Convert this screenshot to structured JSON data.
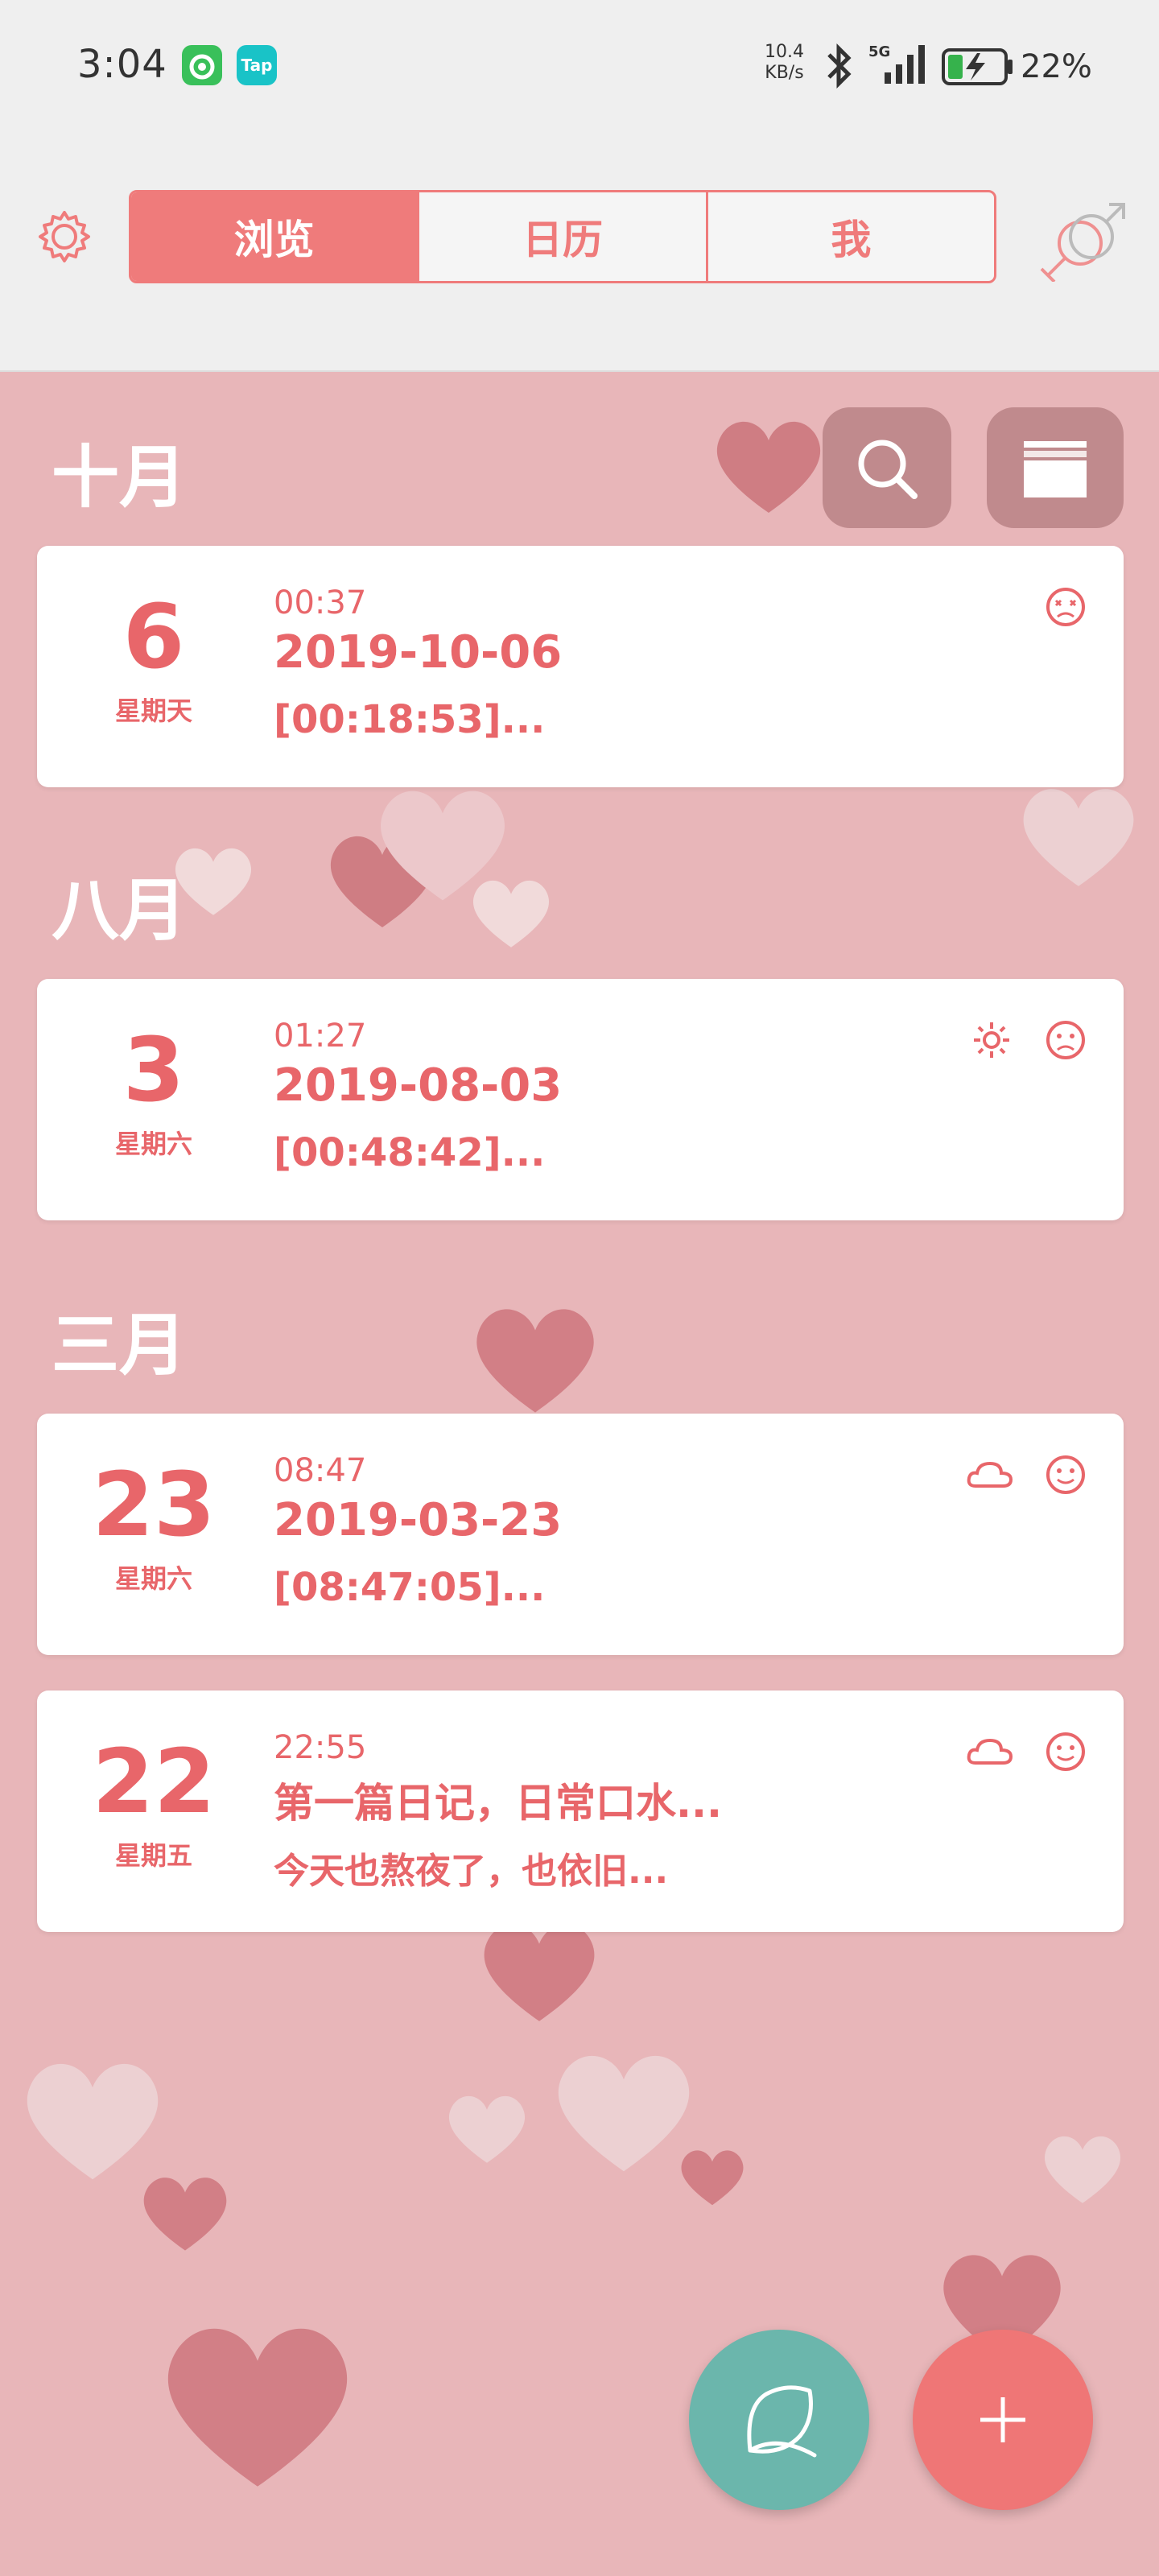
{
  "status": {
    "time": "3:04",
    "tap_label": "Tap",
    "net_speed_value": "10.4",
    "net_speed_unit": "KB/s",
    "network": "5G",
    "battery": "22%"
  },
  "header": {
    "tabs": [
      {
        "label": "浏览",
        "active": true
      },
      {
        "label": "日历",
        "active": false
      },
      {
        "label": "我",
        "active": false
      }
    ]
  },
  "sections": [
    {
      "month": "十月",
      "entries": [
        {
          "day": "6",
          "weekday": "星期天",
          "time": "00:37",
          "title": "2019-10-06",
          "preview": "[00:18:53]...",
          "weather_icon": "",
          "mood_icon": "dizzy-face-icon"
        }
      ]
    },
    {
      "month": "八月",
      "entries": [
        {
          "day": "3",
          "weekday": "星期六",
          "time": "01:27",
          "title": "2019-08-03",
          "preview": "[00:48:42]...",
          "weather_icon": "sun-icon",
          "mood_icon": "sad-face-icon"
        }
      ]
    },
    {
      "month": "三月",
      "entries": [
        {
          "day": "23",
          "weekday": "星期六",
          "time": "08:47",
          "title": "2019-03-23",
          "preview": "[08:47:05]...",
          "weather_icon": "cloud-icon",
          "mood_icon": "smile-face-icon"
        },
        {
          "day": "22",
          "weekday": "星期五",
          "time": "22:55",
          "title": "第一篇日记，日常口水...",
          "preview": "今天也熬夜了，也依旧...",
          "weather_icon": "cloud-icon",
          "mood_icon": "smile-face-icon"
        }
      ]
    }
  ],
  "colors": {
    "accent": "#ef7b7b",
    "background": "#e8b6b9",
    "leaf_fab": "#6bb6ac"
  }
}
